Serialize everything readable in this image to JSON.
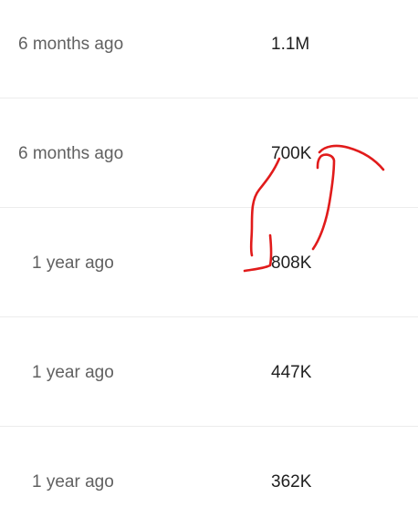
{
  "rows": [
    {
      "date": "6 months ago",
      "views": "1.1M"
    },
    {
      "date": "6 months ago",
      "views": "700K"
    },
    {
      "date": "1 year ago",
      "views": "808K"
    },
    {
      "date": "1 year ago",
      "views": "447K"
    },
    {
      "date": "1 year ago",
      "views": "362K"
    }
  ],
  "annotation": {
    "color": "#e11b1b",
    "description_icon": "hand-drawn-swap-arrows"
  }
}
